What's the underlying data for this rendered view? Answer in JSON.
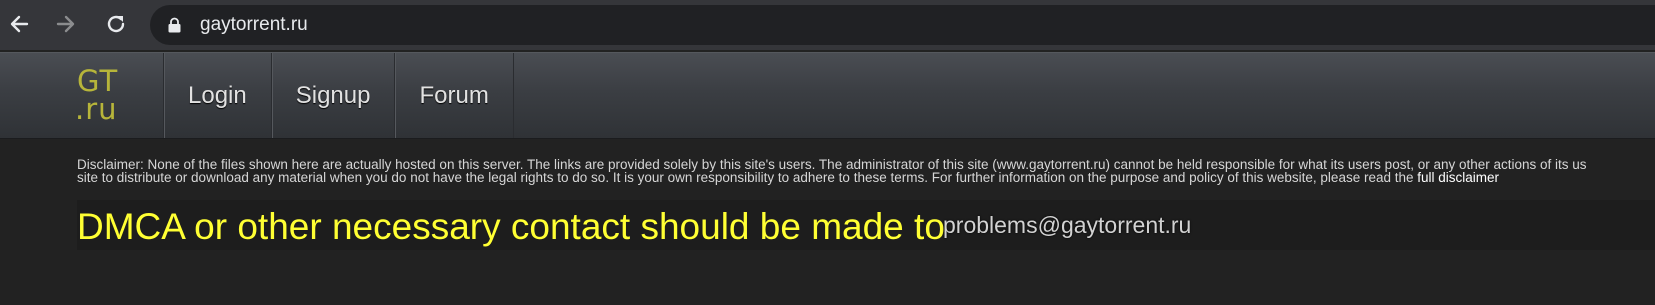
{
  "browser": {
    "back_icon": "arrow-left-icon",
    "forward_icon": "arrow-right-icon",
    "reload_icon": "reload-icon",
    "lock_icon": "lock-icon",
    "url": "gaytorrent.ru"
  },
  "site": {
    "logo_line1": "GT",
    "logo_line2": ".ru",
    "nav": [
      {
        "label": "Login"
      },
      {
        "label": "Signup"
      },
      {
        "label": "Forum"
      }
    ]
  },
  "content": {
    "disclaimer_line1": "Disclaimer: None of the files shown here are actually hosted on this server. The links are provided solely by this site's users. The administrator of this site (www.gaytorrent.ru) cannot be held responsible for what its users post, or any other actions of its us",
    "disclaimer_line2": "site to distribute or download any material when you do not have the legal rights to do so. It is your own responsibility to adhere to these terms. For further information on the purpose and policy of this website, please read the ",
    "disclaimer_link": "full disclaimer",
    "dmca_text": "DMCA or other necessary contact should be made to",
    "dmca_email": "problems@gaytorrent.ru"
  },
  "colors": {
    "logo": "#b7b53a",
    "dmca_text": "#ffff33",
    "background": "#222222",
    "chrome": "#35363a"
  }
}
